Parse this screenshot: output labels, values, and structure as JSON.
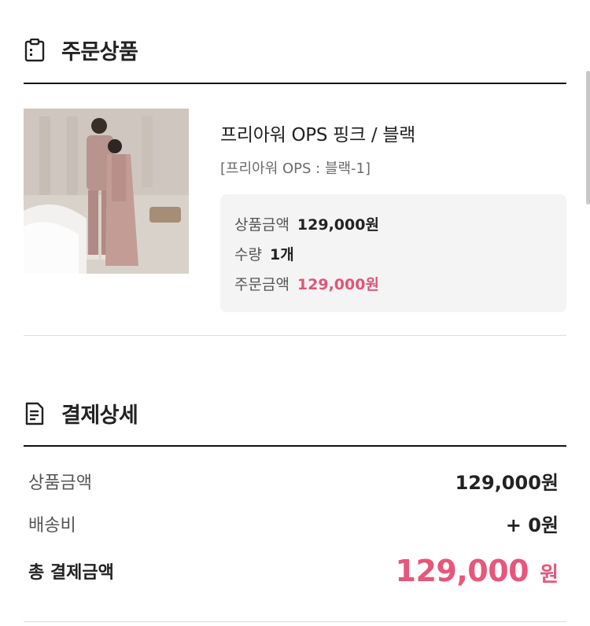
{
  "order_section": {
    "icon": "clipboard-icon",
    "title": "주문상품"
  },
  "product": {
    "image": "product-photo",
    "name": "프리아워 OPS 핑크 / 블랙",
    "option": "[프리아워 OPS : 블랙-1]",
    "price_label": "상품금액",
    "price_value": "129,000원",
    "qty_label": "수량",
    "qty_value": "1개",
    "order_label": "주문금액",
    "order_value": "129,000원"
  },
  "payment_section": {
    "icon": "document-icon",
    "title": "결제상세",
    "item_label": "상품금액",
    "item_value": "129,000원",
    "shipping_label": "배송비",
    "shipping_value": "+ 0원",
    "total_label": "총 결제금액",
    "total_value": "129,000",
    "total_unit": "원"
  },
  "colors": {
    "accent": "#e6577b",
    "text": "#222222",
    "muted": "#6b6b6b",
    "box_bg": "#f4f4f4"
  }
}
